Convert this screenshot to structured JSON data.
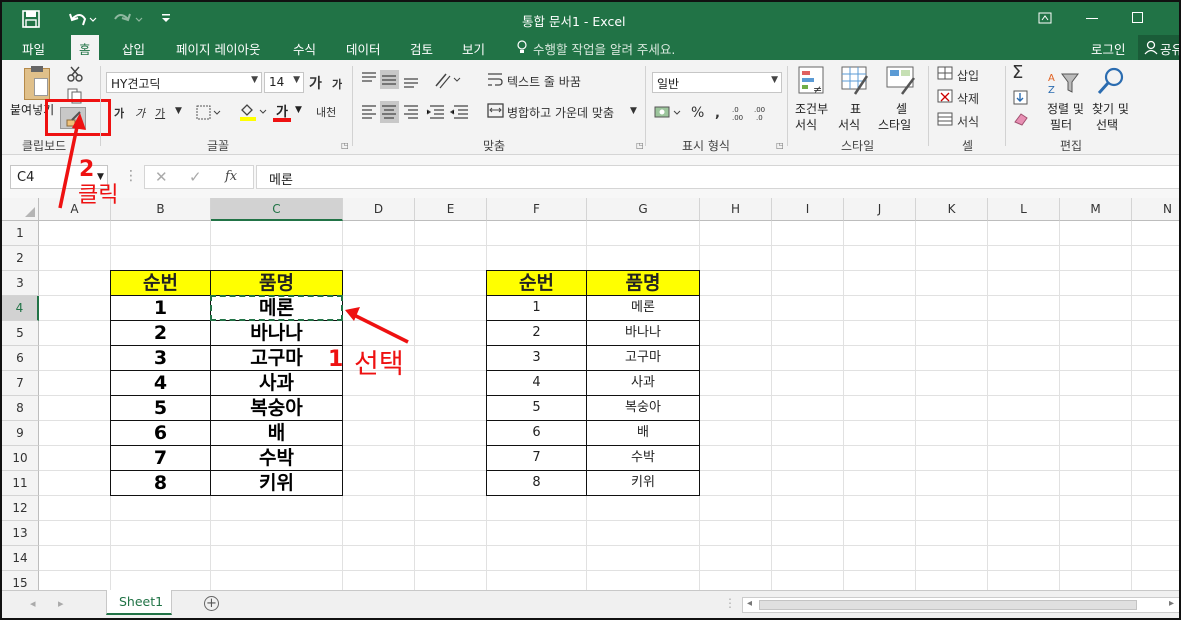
{
  "window": {
    "title": "통합 문서1 - Excel"
  },
  "tabs": [
    {
      "label": "파일"
    },
    {
      "label": "홈"
    },
    {
      "label": "삽입"
    },
    {
      "label": "페이지 레이아웃"
    },
    {
      "label": "수식"
    },
    {
      "label": "데이터"
    },
    {
      "label": "검토"
    },
    {
      "label": "보기"
    }
  ],
  "tellme": "수행할 작업을 알려 주세요.",
  "account": {
    "login": "로그인",
    "share": "공유"
  },
  "ribbon": {
    "clipboard": {
      "paste": "붙여넣기",
      "group": "클립보드"
    },
    "font": {
      "name": "HY견고딕",
      "size": "14",
      "bold": "가",
      "italic": "가",
      "underline": "가",
      "grow": "가",
      "shrink": "가",
      "color_letter": "가",
      "phonetic": "내천",
      "group": "글꼴"
    },
    "align": {
      "wrap": "텍스트 줄 바꿈",
      "merge": "병합하고 가운데 맞춤",
      "group": "맞춤"
    },
    "number": {
      "format": "일반",
      "percent": "%",
      "group": "표시 형식"
    },
    "styles": {
      "cond_line1": "조건부",
      "cond_line2": "서식",
      "table_line1": "표",
      "table_line2": "서식",
      "cell_line1": "셀",
      "cell_line2": "스타일",
      "group": "스타일"
    },
    "cells": {
      "insert": "삽입",
      "delete": "삭제",
      "format": "서식",
      "group": "셀"
    },
    "editing": {
      "sort_line1": "정렬 및",
      "sort_line2": "필터",
      "find_line1": "찾기 및",
      "find_line2": "선택",
      "group": "편집"
    }
  },
  "formula_bar": {
    "name_box": "C4",
    "fx": "fx",
    "value": "메론"
  },
  "columns": [
    "A",
    "B",
    "C",
    "D",
    "E",
    "F",
    "G",
    "H",
    "I",
    "J",
    "K",
    "L",
    "M",
    "N"
  ],
  "rows": [
    "1",
    "2",
    "3",
    "4",
    "5",
    "6",
    "7",
    "8",
    "9",
    "10",
    "11",
    "12",
    "13",
    "14",
    "15"
  ],
  "table_left": {
    "headers": [
      "순번",
      "품명"
    ],
    "rows": [
      [
        "1",
        "메론"
      ],
      [
        "2",
        "바나나"
      ],
      [
        "3",
        "고구마"
      ],
      [
        "4",
        "사과"
      ],
      [
        "5",
        "복숭아"
      ],
      [
        "6",
        "배"
      ],
      [
        "7",
        "수박"
      ],
      [
        "8",
        "키위"
      ]
    ]
  },
  "table_right": {
    "headers": [
      "순번",
      "품명"
    ],
    "rows": [
      [
        "1",
        "메론"
      ],
      [
        "2",
        "바나나"
      ],
      [
        "3",
        "고구마"
      ],
      [
        "4",
        "사과"
      ],
      [
        "5",
        "복숭아"
      ],
      [
        "6",
        "배"
      ],
      [
        "7",
        "수박"
      ],
      [
        "8",
        "키위"
      ]
    ]
  },
  "sheet_tab": "Sheet1",
  "annotations": {
    "step1_num": "1",
    "step1_text": "선택",
    "step2_num": "2",
    "step2_text": "클릭"
  },
  "colors": {
    "excel_green": "#217346",
    "header_fill": "#ffff00",
    "annotation_red": "#ee1111"
  }
}
